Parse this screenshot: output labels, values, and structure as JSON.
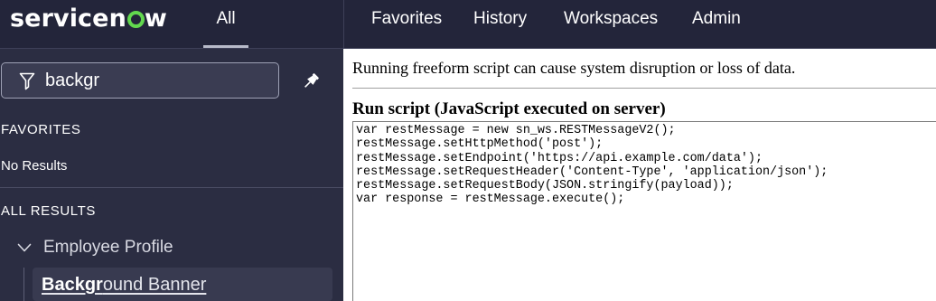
{
  "brand": {
    "logo_pre": "servicen",
    "logo_post": "w",
    "accent": "#62d84e"
  },
  "nav": {
    "tab_all": "All",
    "filter": {
      "value": "backgr"
    },
    "favorites": {
      "title": "FAVORITES",
      "empty": "No Results"
    },
    "all_results": {
      "title": "ALL RESULTS",
      "group": "Employee Profile",
      "item": {
        "match": "Backgr",
        "rest": "ound Banner"
      }
    }
  },
  "topnav": {
    "favorites": "Favorites",
    "history": "History",
    "workspaces": "Workspaces",
    "admin": "Admin"
  },
  "content": {
    "warning": "Running freeform script can cause system disruption or loss of data.",
    "run_title": "Run script (JavaScript executed on server)",
    "script_lines": [
      "var restMessage = new sn_ws.RESTMessageV2();",
      "restMessage.setHttpMethod('post');",
      "restMessage.setEndpoint('https://api.example.com/data');",
      "restMessage.setRequestHeader('Content-Type', 'application/json');",
      "restMessage.setRequestBody(JSON.stringify(payload));",
      "var response = restMessage.execute();"
    ]
  },
  "icons": {
    "filter": "filter-funnel-icon",
    "pin": "pin-icon",
    "chevron": "chevron-down-icon"
  }
}
